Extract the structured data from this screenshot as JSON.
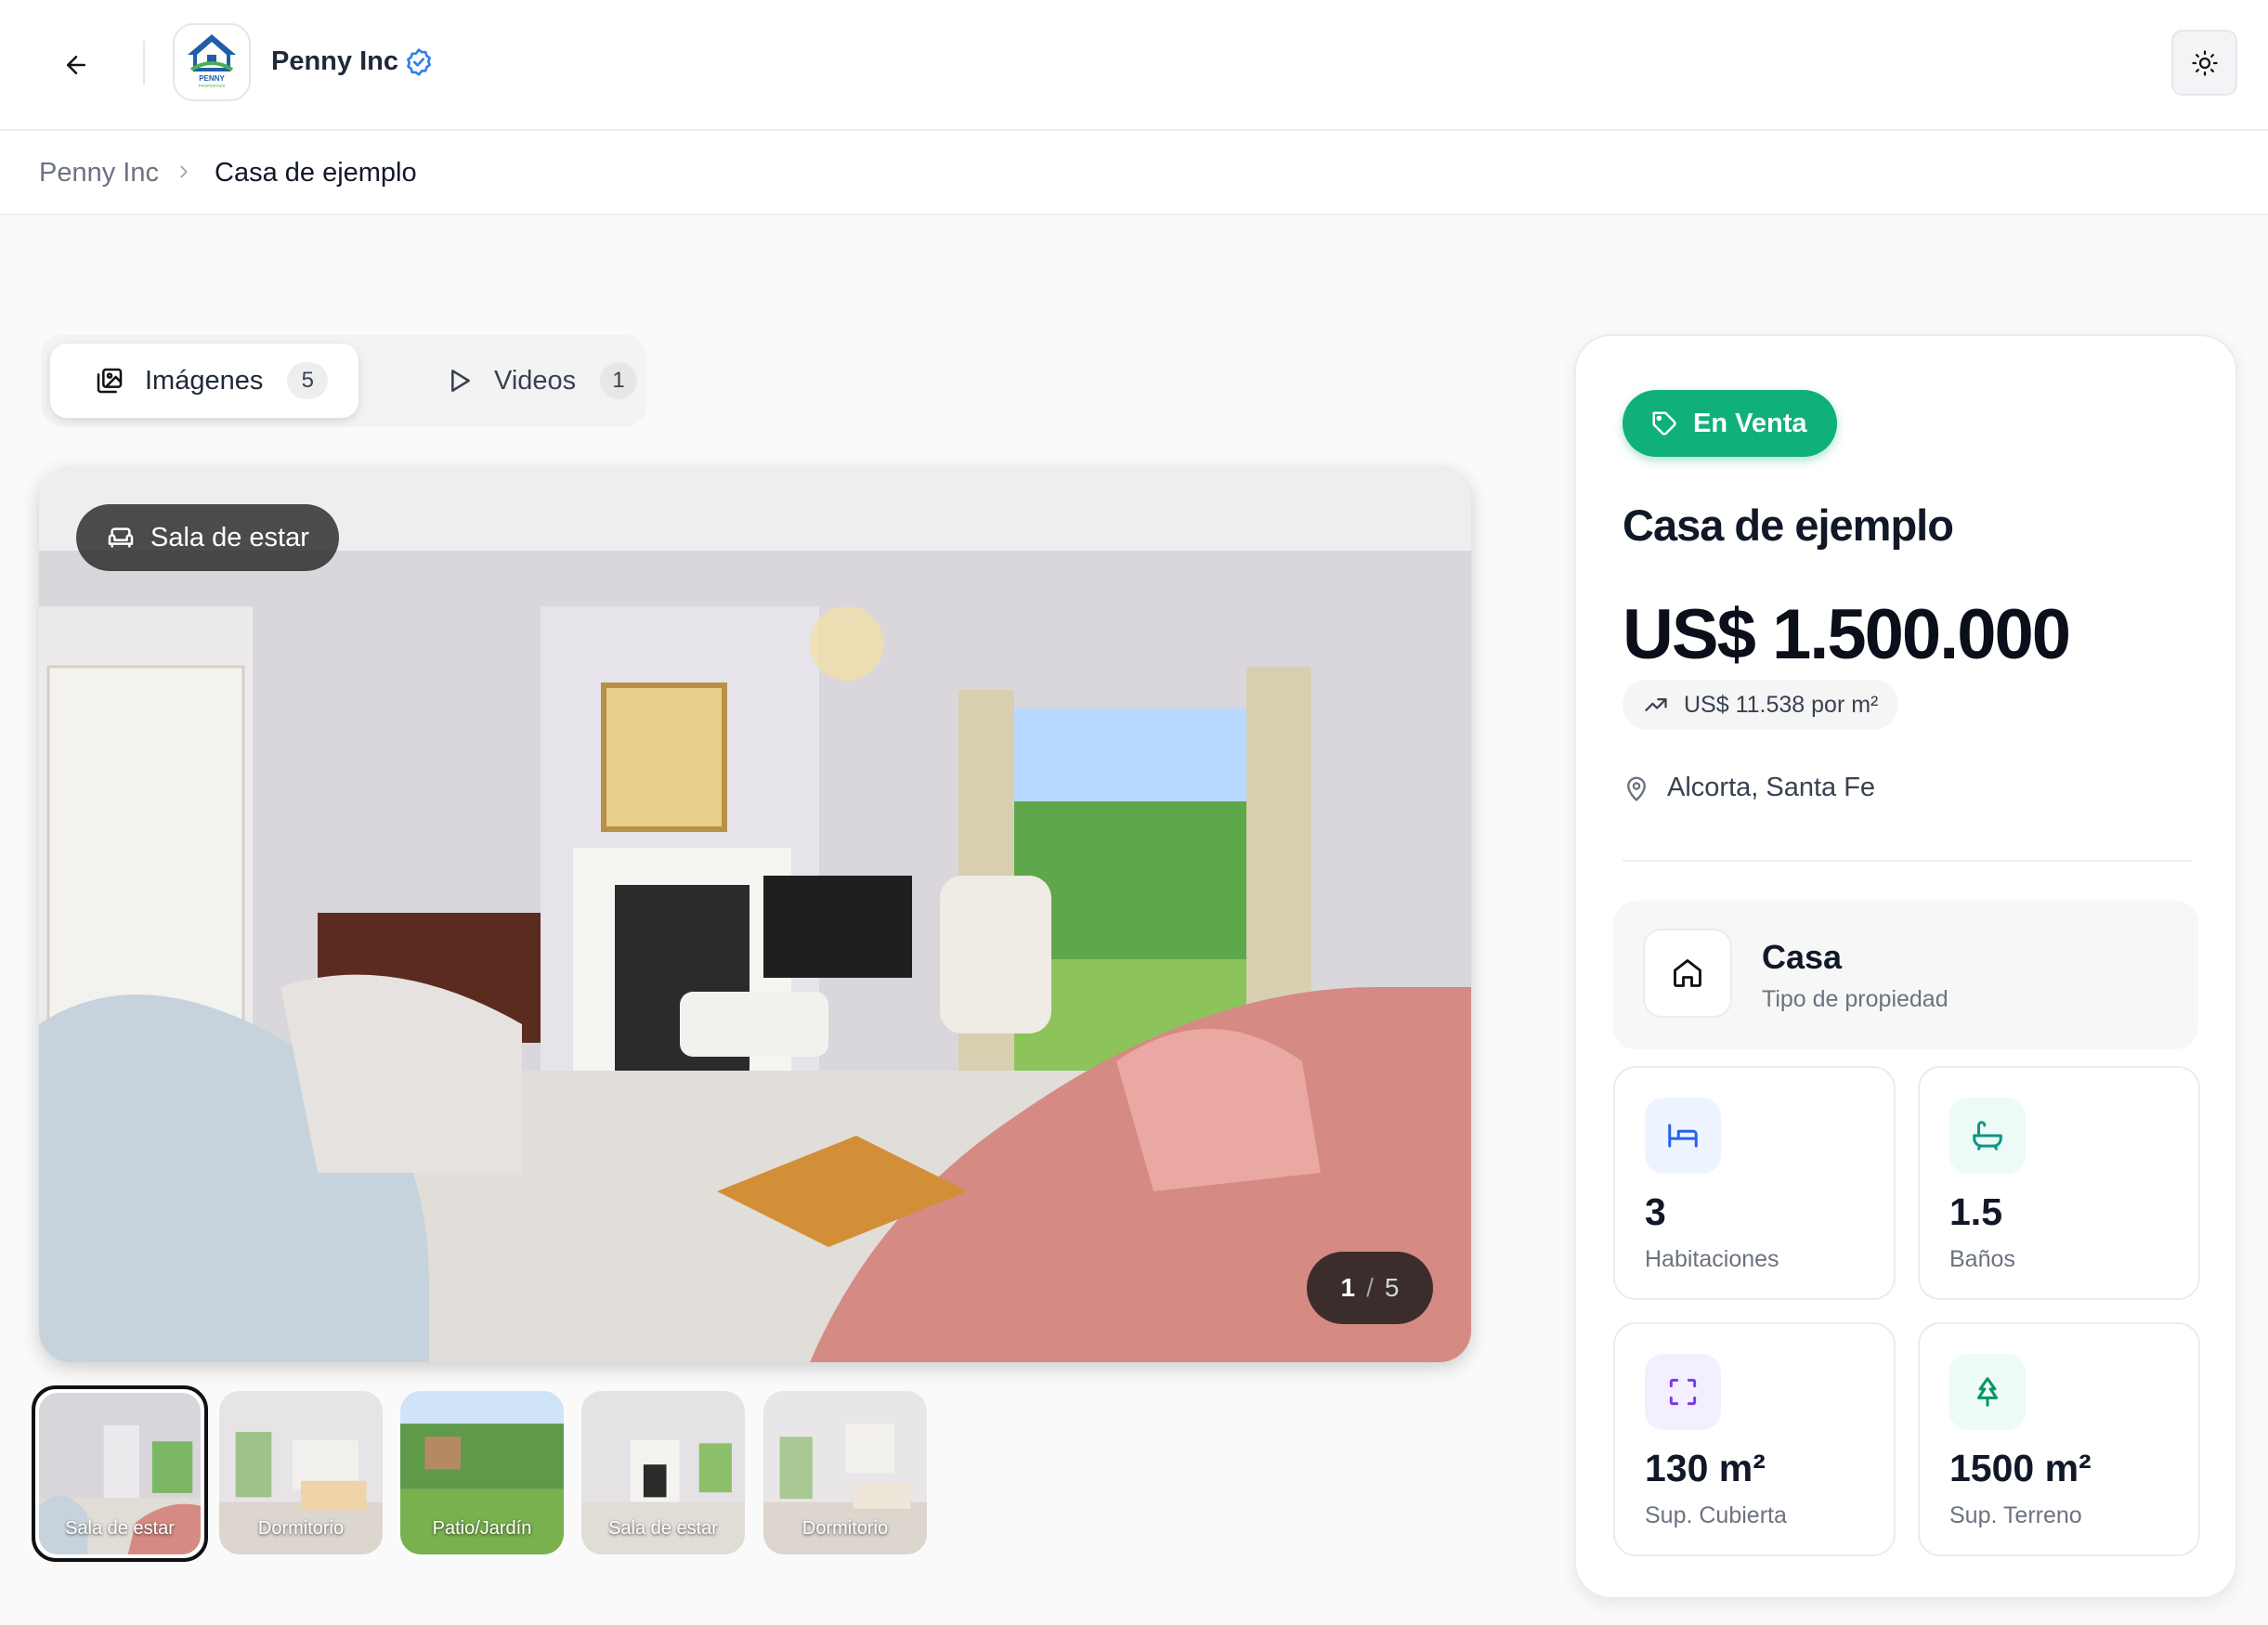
{
  "header": {
    "brand_name": "Penny Inc",
    "logo_text": "PENNY",
    "logo_subtext": "PROPERTIES"
  },
  "breadcrumb": {
    "root": "Penny Inc",
    "current": "Casa de ejemplo"
  },
  "media_tabs": [
    {
      "label": "Imágenes",
      "count": "5",
      "icon": "images-icon",
      "active": true
    },
    {
      "label": "Videos",
      "count": "1",
      "icon": "play-icon",
      "active": false
    }
  ],
  "gallery": {
    "current_room": "Sala de estar",
    "counter_current": "1",
    "counter_separator": "/",
    "counter_total": "5",
    "thumbnails": [
      {
        "label": "Sala de estar",
        "selected": true
      },
      {
        "label": "Dormitorio",
        "selected": false
      },
      {
        "label": "Patio/Jardín",
        "selected": false
      },
      {
        "label": "Sala de estar",
        "selected": false
      },
      {
        "label": "Dormitorio",
        "selected": false
      }
    ]
  },
  "listing": {
    "status": "En Venta",
    "title": "Casa de ejemplo",
    "price": "US$ 1.500.000",
    "price_per_m2": "US$ 11.538 por m²",
    "location": "Alcorta, Santa Fe",
    "property_type": "Casa",
    "property_type_label": "Tipo de propiedad",
    "features": [
      {
        "value": "3",
        "label": "Habitaciones",
        "icon": "bed-icon"
      },
      {
        "value": "1.5",
        "label": "Baños",
        "icon": "bathtub-icon"
      },
      {
        "value": "130 m²",
        "label": "Sup. Cubierta",
        "icon": "area-icon"
      },
      {
        "value": "1500 m²",
        "label": "Sup. Terreno",
        "icon": "tree-icon"
      }
    ]
  },
  "colors": {
    "accent_green": "#10b07a",
    "bed_bg": "#eef4ff",
    "bath_bg": "#ecfbf6",
    "area_bg": "#f4efff",
    "tree_bg": "#ecfbf3"
  }
}
